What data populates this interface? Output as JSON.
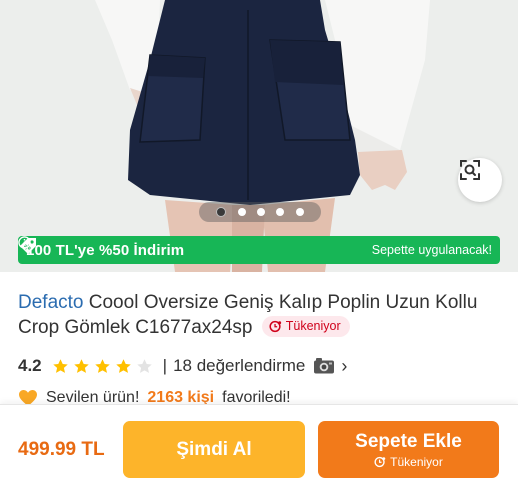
{
  "promo": {
    "discount_text": "100 TL'ye %50 İndirim",
    "note": "Sepette uygulanacak!",
    "tag_icon": "tag-percent-icon",
    "info_icon": "info-icon",
    "color": "#17b656"
  },
  "gallery": {
    "image_count": 5,
    "active_index": 0,
    "zoom_icon": "zoom-icon"
  },
  "product": {
    "brand": "Defacto",
    "name": "Coool Oversize Geniş Kalıp Poplin Uzun Kollu Crop Gömlek C1677ax24sp",
    "stock_badge": "Tükeniyor",
    "rating": "4.2",
    "stars": 4,
    "reviews": "18 değerlendirme",
    "favorites": {
      "prefix": "Sevilen ürün!",
      "count": "2163 kişi",
      "suffix": "favoriledi!"
    }
  },
  "bottom_bar": {
    "price": "499.99 TL",
    "buy_now": "Şimdi Al",
    "add_to_cart": "Sepete Ekle",
    "cart_status": "Tükeniyor"
  },
  "colors": {
    "brand_link": "#2b6cb0",
    "accent_orange": "#f27a1a",
    "buy_yellow": "#fdb42a",
    "stock_red": "#d0021b"
  }
}
